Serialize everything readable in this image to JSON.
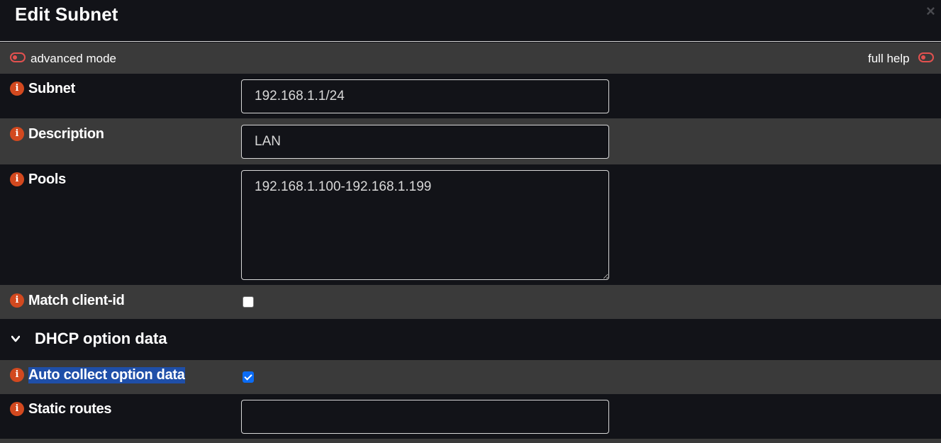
{
  "dialog": {
    "title": "Edit Subnet",
    "close_icon": "close-icon"
  },
  "modebar": {
    "advanced_mode_label": "advanced mode",
    "advanced_mode_on": false,
    "full_help_label": "full help",
    "full_help_on": false
  },
  "fields": {
    "subnet": {
      "label": "Subnet",
      "value": "192.168.1.1/24"
    },
    "description": {
      "label": "Description",
      "value": "LAN"
    },
    "pools": {
      "label": "Pools",
      "value": "192.168.1.100-192.168.1.199"
    },
    "match_client_id": {
      "label": "Match client-id",
      "checked": false
    },
    "dhcp_section": {
      "title": "DHCP option data",
      "expanded": true
    },
    "auto_collect": {
      "label": "Auto collect option data",
      "checked": true
    },
    "static_routes": {
      "label": "Static routes",
      "value": ""
    }
  },
  "colors": {
    "background": "#121318",
    "row_alt": "#3a3a3a",
    "toggle_accent": "#e2514f",
    "info_icon": "#d2491f",
    "checkbox_checked": "#0b6cf5",
    "selection_highlight": "#1f4fa8"
  }
}
